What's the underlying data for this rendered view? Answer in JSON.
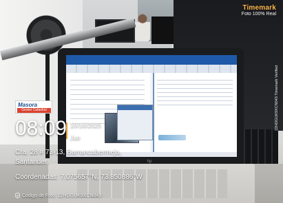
{
  "watermark": {
    "app_name": "Timemark",
    "tagline": "Foto 100% Real",
    "vertical_tag": "22HDGUK9XCN043  Timemark Verified",
    "accent_color": "#ffb84d"
  },
  "brand_logo": {
    "name": "Masora",
    "subtitle": "Gestor Catastral",
    "primary_color": "#1b4f8c",
    "secondary_color": "#d9432f"
  },
  "stamp": {
    "time": "08:09",
    "date": "10/16/2025",
    "weekday": "Jue",
    "address_line1": "Cra. 28 # 73-13, Barrancabermeja,",
    "address_line2": "Santander",
    "coordinates": "Coordenadas: 7.075657°N, 73.850886°W",
    "photo_code": "Código de Foto: 22HDGUK9XCN043",
    "divider_color": "#e8a23a"
  },
  "scene": {
    "laptop_brand_mark": "hp"
  }
}
